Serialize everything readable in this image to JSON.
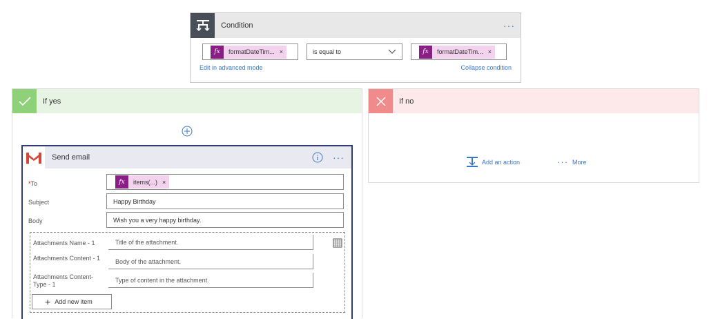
{
  "condition": {
    "title": "Condition",
    "more": "···",
    "left_token": "formatDateTim...",
    "operator": "is equal to",
    "right_token": "formatDateTim...",
    "edit_link": "Edit in advanced mode",
    "collapse_link": "Collapse condition",
    "fx": "fx",
    "remove": "×"
  },
  "if_yes": {
    "title": "If yes",
    "send_email": {
      "title": "Send email",
      "more": "···",
      "to_required": "*",
      "to_label": "To",
      "to_token": "items(...)",
      "subject_label": "Subject",
      "subject_value": "Happy Birthday",
      "body_label": "Body",
      "body_value": "Wish you a very happy birthday.",
      "attachments": [
        {
          "label": "Attachments Name - 1",
          "placeholder": "Title of the attachment."
        },
        {
          "label": "Attachments Content - 1",
          "placeholder": "Body of the attachment."
        },
        {
          "label": "Attachments Content-Type - 1",
          "placeholder": "Type of content in the attachment."
        }
      ],
      "add_new_item": "Add new item"
    }
  },
  "if_no": {
    "title": "If no",
    "add_action": "Add an action",
    "more": "More"
  },
  "colors": {
    "accent_blue": "#3a78c6",
    "fx_purple": "#8b1d87",
    "token_pink": "#f3d2ee",
    "yes_green": "#8fd179",
    "no_red": "#f08b8b",
    "condition_dark": "#484f58"
  }
}
